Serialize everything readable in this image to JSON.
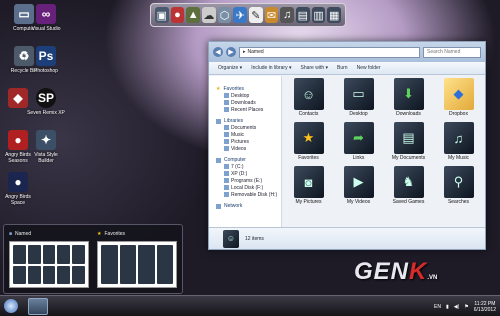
{
  "desktop_icons": [
    {
      "label": "Computer",
      "color": "#5b6f8c",
      "glyph": "computer"
    },
    {
      "label": "Recycle Bin",
      "color": "#4c5a6a",
      "glyph": "recycle-bin"
    },
    {
      "label": "Visual Studio",
      "color": "#68217a",
      "glyph": "visual-studio"
    },
    {
      "label": "Photoshop",
      "color": "#1c3f7a",
      "glyph": "photoshop"
    },
    {
      "label": "Angry Birds Seasons",
      "color": "#b02020",
      "glyph": "angry-birds"
    },
    {
      "label": "Angry Birds Space",
      "color": "#1a2550",
      "glyph": "angry-birds-space"
    },
    {
      "label": "Seven Remix XP",
      "color": "#111111",
      "glyph": "sp-logo"
    },
    {
      "label": "Vista Style Builder",
      "color": "#3b4f66",
      "glyph": "style-builder"
    }
  ],
  "dock": {
    "items": [
      "app-1",
      "app-2",
      "app-3",
      "app-4",
      "app-5",
      "app-6",
      "app-7",
      "app-8",
      "app-9",
      "app-10",
      "app-11",
      "app-12"
    ]
  },
  "explorer": {
    "address": "Named",
    "search_placeholder": "Search Named",
    "toolbar": [
      "Organize ▾",
      "Include in library ▾",
      "Share with ▾",
      "Burn",
      "New folder"
    ],
    "nav": {
      "favorites": {
        "title": "Favorites",
        "items": [
          "Desktop",
          "Downloads",
          "Recent Places"
        ]
      },
      "libraries": {
        "title": "Libraries",
        "items": [
          "Documents",
          "Music",
          "Pictures",
          "Videos"
        ]
      },
      "computer": {
        "title": "Computer",
        "items": [
          "7 (C:)",
          "XP (D:)",
          "Programs (E:)",
          "Local Disk (F:)",
          "Removable Disk (H:)"
        ]
      },
      "network": {
        "title": "Network"
      }
    },
    "items": [
      {
        "label": "Contacts",
        "glyph": "contacts"
      },
      {
        "label": "Desktop",
        "glyph": "desktop"
      },
      {
        "label": "Downloads",
        "glyph": "downloads"
      },
      {
        "label": "Dropbox",
        "glyph": "dropbox"
      },
      {
        "label": "Favorites",
        "glyph": "favorites"
      },
      {
        "label": "Links",
        "glyph": "links"
      },
      {
        "label": "My Documents",
        "glyph": "documents"
      },
      {
        "label": "My Music",
        "glyph": "music"
      },
      {
        "label": "My Pictures",
        "glyph": "pictures"
      },
      {
        "label": "My Videos",
        "glyph": "videos"
      },
      {
        "label": "Saved Games",
        "glyph": "saved-games"
      },
      {
        "label": "Searches",
        "glyph": "searches"
      }
    ],
    "status": "12 items"
  },
  "thumbnails": [
    {
      "title": "Named"
    },
    {
      "title": "Favorites"
    }
  ],
  "tray": {
    "lang": "EN",
    "time": "11:22 PM",
    "date": "6/13/2012"
  },
  "watermark": {
    "part1": "GEN",
    "part2": "K",
    "suffix": ".VN"
  }
}
